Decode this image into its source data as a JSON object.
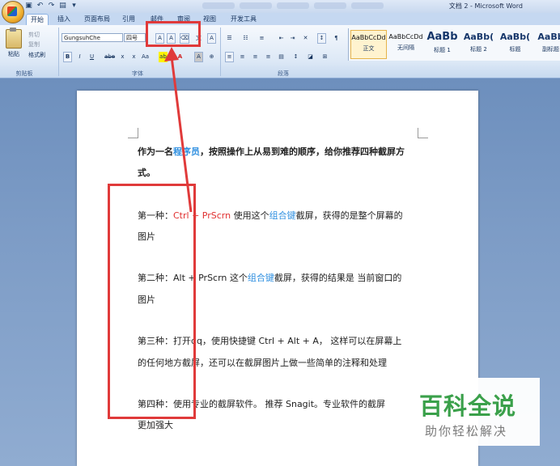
{
  "window": {
    "title": "文档 2 - Microsoft Word"
  },
  "ribbon_tabs": [
    "开始",
    "插入",
    "页面布局",
    "引用",
    "邮件",
    "审阅",
    "视图",
    "开发工具"
  ],
  "clipboard": {
    "paste": "粘贴",
    "cut": "剪切",
    "copy": "复制",
    "format_painter": "格式刷",
    "group": "剪贴板"
  },
  "font": {
    "name": "GungsuhChe",
    "size": "四号",
    "grow": "A",
    "shrink": "A",
    "clear": "",
    "phonetic": "",
    "border": "A",
    "bold": "B",
    "italic": "I",
    "underline": "U",
    "strike": "abe",
    "subscript": "x",
    "superscript": "x",
    "case": "Aa",
    "highlight": "ab",
    "color": "A",
    "shading": "A",
    "enclose": "",
    "group": "字体"
  },
  "paragraph": {
    "group": "段落"
  },
  "styles": [
    {
      "sample": "AaBbCcDd",
      "name": "正文",
      "selected": true
    },
    {
      "sample": "AaBbCcDd",
      "name": "无间隔",
      "selected": false
    },
    {
      "sample": "AaBb",
      "name": "标题 1",
      "selected": false
    },
    {
      "sample": "AaBb(",
      "name": "标题 2",
      "selected": false
    },
    {
      "sample": "AaBb(",
      "name": "标题",
      "selected": false
    },
    {
      "sample": "AaBb",
      "name": "副标题",
      "selected": false
    }
  ],
  "document": {
    "intro_pre": "作为一名",
    "intro_link": "程序员",
    "intro_post": "，按照操作上从易到难的顺序，给你推荐四种截屏方",
    "intro_line2": "式。",
    "m1_pre": "第一种：",
    "m1_key": "Ctrl + PrScrn",
    "m1_mid": " 使用这个",
    "m1_link": "组合键",
    "m1_post": "截屏，获得的是整个屏幕的",
    "m1_line2": "图片",
    "m2_pre": "第二种：Alt + PrScrn  这个",
    "m2_link": "组合键",
    "m2_post": "截屏，获得的结果是 当前窗口的",
    "m2_line2": "图片",
    "m3_line1": "第三种：打开qq，使用快捷键 Ctrl + Alt + A， 这样可以在屏幕上",
    "m3_line2": "的任何地方截屏，还可以在截屏图片上做一些简单的注释和处理",
    "m4_line1": "第四种：使用专业的截屏软件。 推荐 Snagit。专业软件的截屏",
    "m4_line2": "更加强大"
  },
  "watermark": {
    "title": "百科全说",
    "subtitle": "助你轻松解决"
  },
  "colors": {
    "highlight_box": "#e03a3a",
    "link": "#3090e0",
    "hotkey_red": "#e03030",
    "watermark_green": "#3aa04a"
  }
}
